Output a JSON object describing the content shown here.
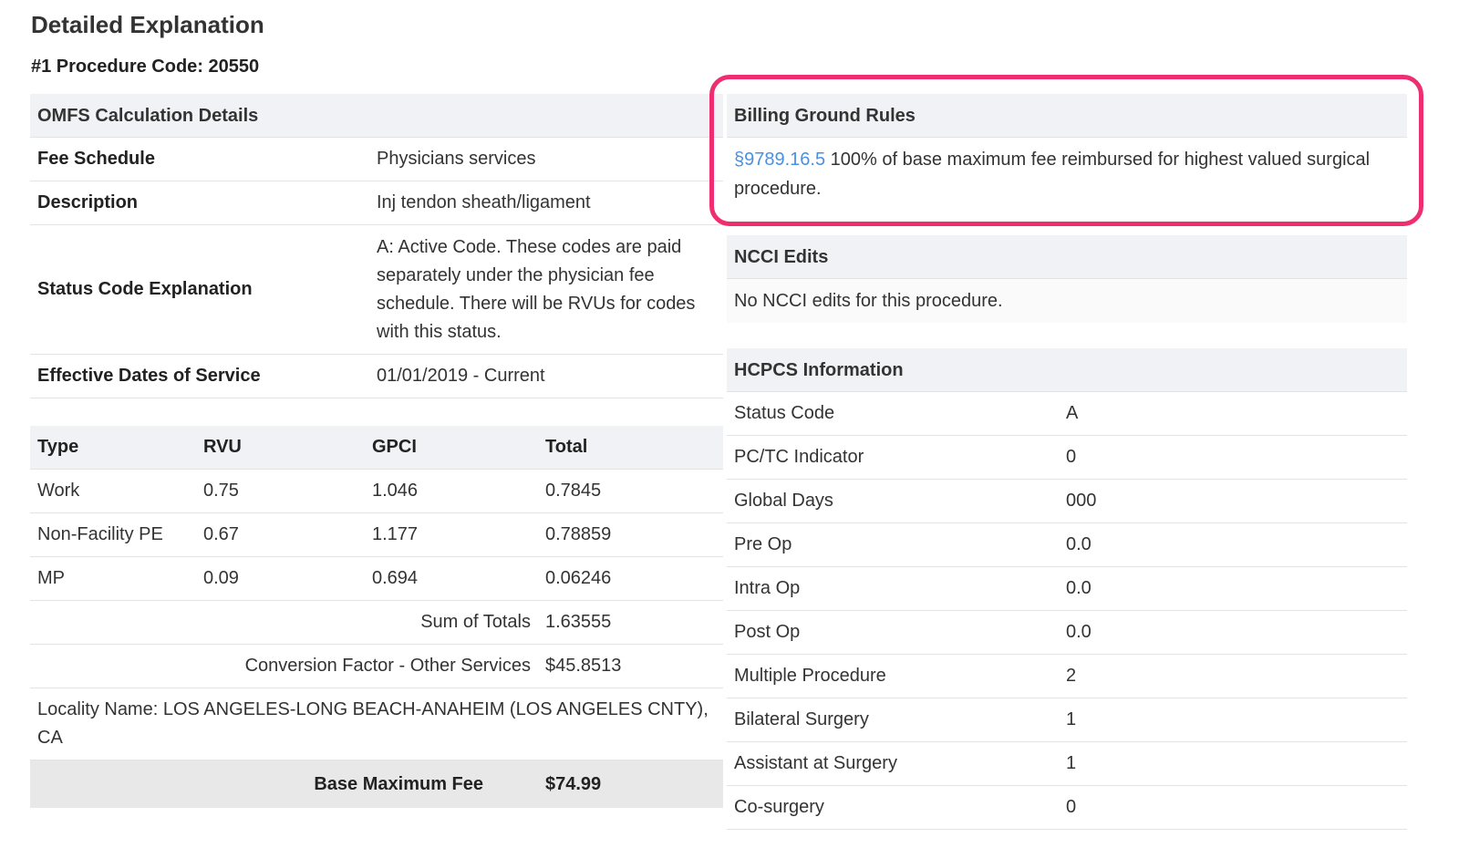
{
  "page_title": "Detailed Explanation",
  "procedure_heading": "#1 Procedure Code: 20550",
  "omfs": {
    "header": "OMFS Calculation Details",
    "rows": [
      {
        "key": "Fee Schedule",
        "value": "Physicians services"
      },
      {
        "key": "Description",
        "value": "Inj tendon sheath/ligament"
      },
      {
        "key": "Status Code Explanation",
        "value": "A: Active Code. These codes are paid separately under the physician fee schedule. There will be RVUs for codes with this status."
      },
      {
        "key": "Effective Dates of Service",
        "value": "01/01/2019 - Current"
      }
    ]
  },
  "rvu_table": {
    "headers": [
      "Type",
      "RVU",
      "GPCI",
      "Total"
    ],
    "rows": [
      [
        "Work",
        "0.75",
        "1.046",
        "0.7845"
      ],
      [
        "Non-Facility PE",
        "0.67",
        "1.177",
        "0.78859"
      ],
      [
        "MP",
        "0.09",
        "0.694",
        "0.06246"
      ]
    ],
    "sum_label": "Sum of Totals",
    "sum_value": "1.63555",
    "conversion_label": "Conversion Factor - Other Services",
    "conversion_value": "$45.8513",
    "locality": "Locality Name: LOS ANGELES-LONG BEACH-ANAHEIM (LOS ANGELES CNTY), CA",
    "base_label": "Base Maximum Fee",
    "base_value": "$74.99"
  },
  "billing": {
    "header": "Billing Ground Rules",
    "link_text": "§9789.16.5",
    "text": " 100% of base maximum fee reimbursed for highest valued surgical procedure.",
    "highlight_color": "#ee2e70",
    "link_color": "#4a90e2"
  },
  "ncci": {
    "header": "NCCI Edits",
    "text": "No NCCI edits for this procedure."
  },
  "hcpcs": {
    "header": "HCPCS Information",
    "rows": [
      {
        "key": "Status Code",
        "value": "A"
      },
      {
        "key": "PC/TC Indicator",
        "value": "0"
      },
      {
        "key": "Global Days",
        "value": "000"
      },
      {
        "key": "Pre Op",
        "value": "0.0"
      },
      {
        "key": "Intra Op",
        "value": "0.0"
      },
      {
        "key": "Post Op",
        "value": "0.0"
      },
      {
        "key": "Multiple Procedure",
        "value": "2"
      },
      {
        "key": "Bilateral Surgery",
        "value": "1"
      },
      {
        "key": "Assistant at Surgery",
        "value": "1"
      },
      {
        "key": "Co-surgery",
        "value": "0"
      }
    ]
  }
}
